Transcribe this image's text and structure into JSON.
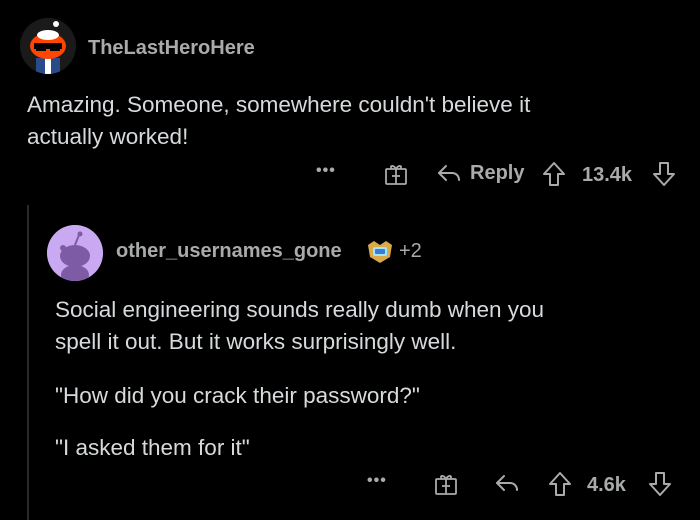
{
  "comment1": {
    "username": "TheLastHeroHere",
    "body": [
      "Amazing. Someone, somewhere couldn't believe it",
      "actually worked!"
    ],
    "actions": {
      "more_label": "•••",
      "reply_label": "Reply",
      "score": "13.4k"
    }
  },
  "comment2": {
    "username": "other_usernames_gone",
    "award_count": "+2",
    "paragraphs": [
      [
        "Social engineering sounds really dumb when you",
        "spell it out. But it works surprisingly well."
      ],
      [
        "\"How did you crack their password?\""
      ],
      [
        "\"I asked them for it\""
      ]
    ],
    "actions": {
      "more_label": "•••",
      "score": "4.6k"
    }
  },
  "colors": {
    "background": "#000000",
    "text": "#d7dadc",
    "muted": "#a8aaab",
    "avatar2_bg": "#c9a9f2"
  },
  "icons": [
    "avatar-snoo-sunglasses",
    "gift-icon",
    "reply-arrow-icon",
    "upvote-icon",
    "downvote-icon",
    "award-icon",
    "more-icon"
  ]
}
